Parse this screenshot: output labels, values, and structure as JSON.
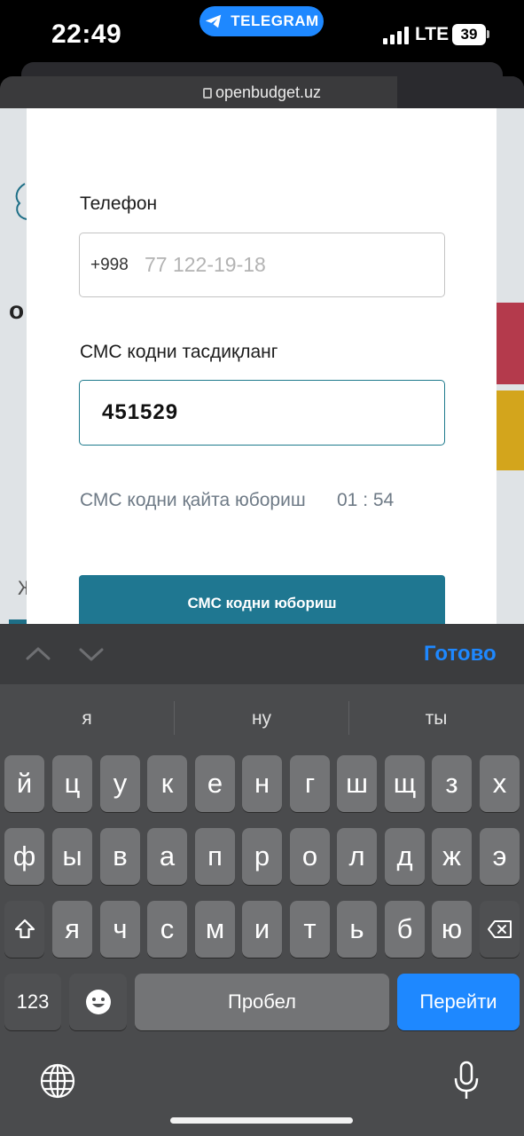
{
  "status": {
    "time": "22:49",
    "app_pill": "TELEGRAM",
    "network": "LTE",
    "battery": "39"
  },
  "browser": {
    "url": "openbudget.uz"
  },
  "background_page": {
    "left_letter_top": "о",
    "left_letter_bottom": "Ж"
  },
  "form": {
    "phone_label": "Телефон",
    "phone_prefix": "+998",
    "phone_placeholder": "77 122-19-18",
    "sms_label": "СМС кодни тасдиқланг",
    "sms_code": "451529",
    "resend_text": "СМС кодни қайта юбориш",
    "resend_timer": "01 : 54",
    "send_button": "СМС кодни юбориш"
  },
  "keyboard": {
    "done_label": "Готово",
    "suggestions": [
      "я",
      "ну",
      "ты"
    ],
    "row1": [
      "й",
      "ц",
      "у",
      "к",
      "е",
      "н",
      "г",
      "ш",
      "щ",
      "з",
      "х"
    ],
    "row2": [
      "ф",
      "ы",
      "в",
      "а",
      "п",
      "р",
      "о",
      "л",
      "д",
      "ж",
      "э"
    ],
    "row3": [
      "я",
      "ч",
      "с",
      "м",
      "и",
      "т",
      "ь",
      "б",
      "ю"
    ],
    "numbers_label": "123",
    "space_label": "Пробел",
    "go_label": "Перейти"
  },
  "colors": {
    "accent": "#1f7791",
    "keyboard_blue": "#1e88ff",
    "telegram_blue": "#1e88ff"
  }
}
